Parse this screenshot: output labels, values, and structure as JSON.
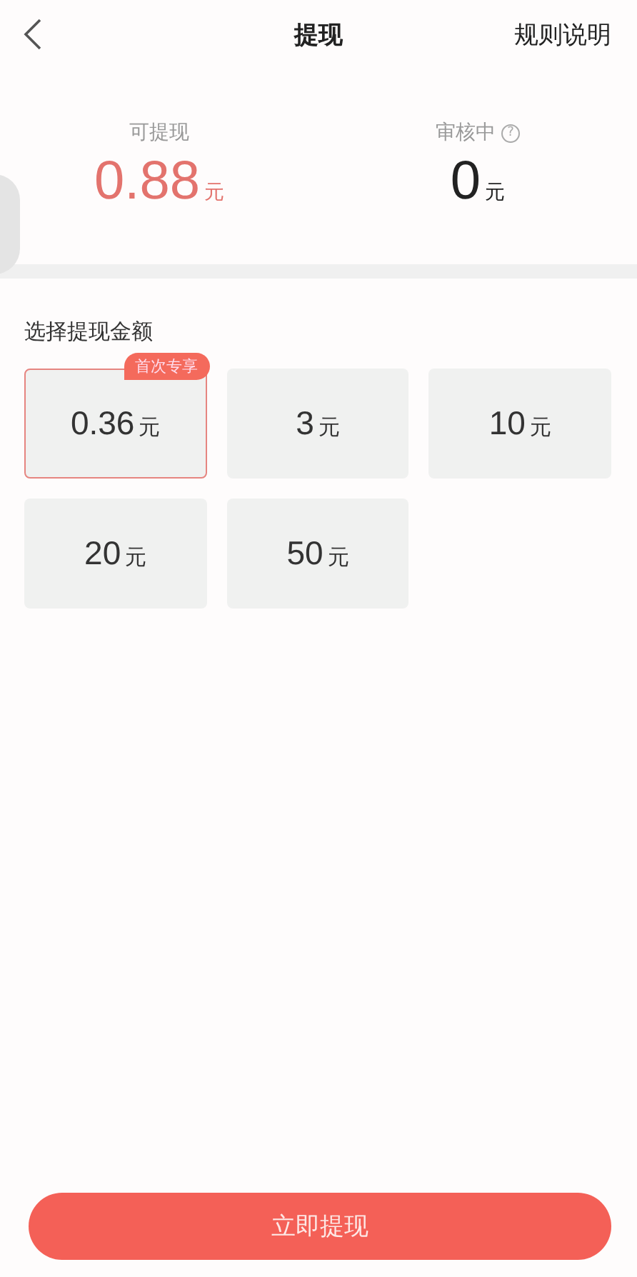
{
  "header": {
    "title": "提现",
    "action": "规则说明"
  },
  "balances": [
    {
      "label": "可提现",
      "amount": "0.88",
      "unit": "元",
      "kind": "available"
    },
    {
      "label": "审核中",
      "amount": "0",
      "unit": "元",
      "kind": "pending",
      "help": "?"
    }
  ],
  "section_title": "选择提现金额",
  "amounts": [
    {
      "value": "0.36",
      "unit": "元",
      "selected": true,
      "badge": "首次专享"
    },
    {
      "value": "3",
      "unit": "元",
      "selected": false
    },
    {
      "value": "10",
      "unit": "元",
      "selected": false
    },
    {
      "value": "20",
      "unit": "元",
      "selected": false
    },
    {
      "value": "50",
      "unit": "元",
      "selected": false
    }
  ],
  "submit": "立即提现"
}
